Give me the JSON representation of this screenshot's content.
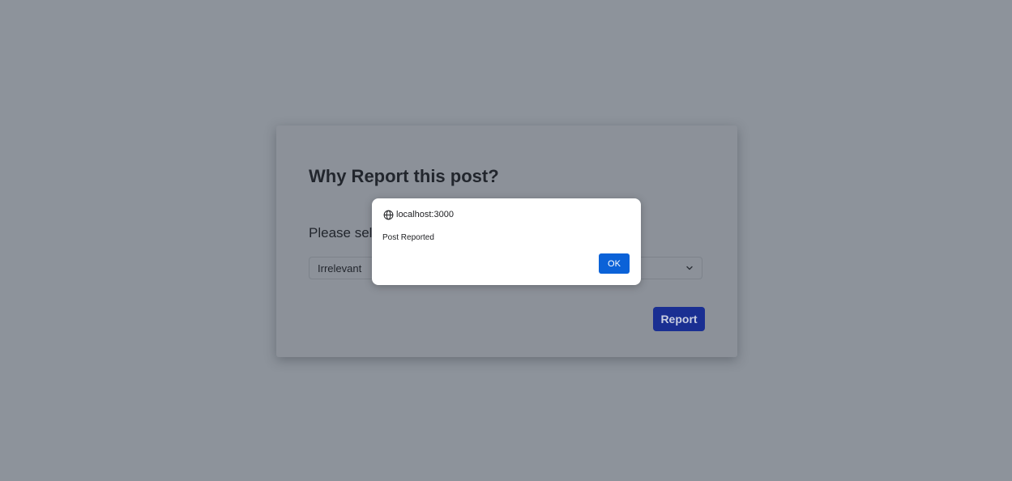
{
  "report_modal": {
    "title": "Why Report this post?",
    "select_label": "Please sele",
    "reason_select": {
      "selected_value": "Irrelevant",
      "icon": "chevron-down-icon"
    },
    "submit_label": "Report"
  },
  "alert_dialog": {
    "origin_icon": "globe-icon",
    "origin": "localhost:3000",
    "message": "Post Reported",
    "ok_label": "OK"
  },
  "colors": {
    "overlay": "#8d939b",
    "report_button": "#1a2f92",
    "ok_button": "#0b62d8"
  }
}
